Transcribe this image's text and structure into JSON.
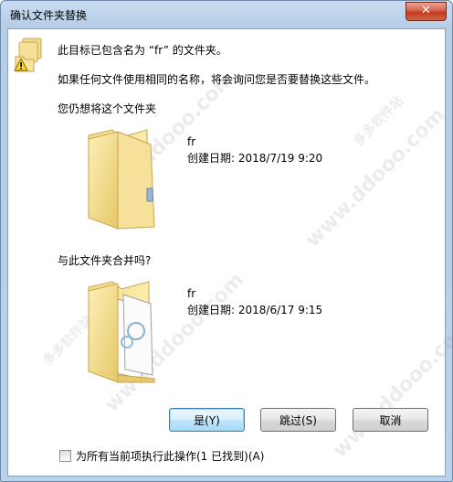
{
  "window": {
    "title": "确认文件夹替换",
    "close_glyph": "✕"
  },
  "messages": {
    "line1": "此目标已包含名为 “fr” 的文件夹。",
    "line2": "如果任何文件使用相同的名称，将会询问您是否要替换这些文件。",
    "line3": "您仍想将这个文件夹",
    "line4": "与此文件夹合并吗?"
  },
  "source_folder": {
    "name": "fr",
    "created": "创建日期: 2018/7/19 9:20"
  },
  "target_folder": {
    "name": "fr",
    "created": "创建日期: 2018/6/17 9:15"
  },
  "buttons": {
    "yes": "是(Y)",
    "skip": "跳过(S)",
    "cancel": "取消"
  },
  "checkbox": {
    "label": "为所有当前项执行此操作(1 已找到)(A)",
    "checked": false
  },
  "watermark": {
    "text1": "www.ddooo.com",
    "text2": "多多软件站"
  },
  "icons": {
    "warning": "warning-folder-icon",
    "folder": "folder-icon",
    "folder_files": "folder-with-files-icon"
  },
  "colors": {
    "title_bar": "#b9d1ea",
    "close_button": "#c23b1e",
    "default_button_border": "#3c7fb1"
  }
}
